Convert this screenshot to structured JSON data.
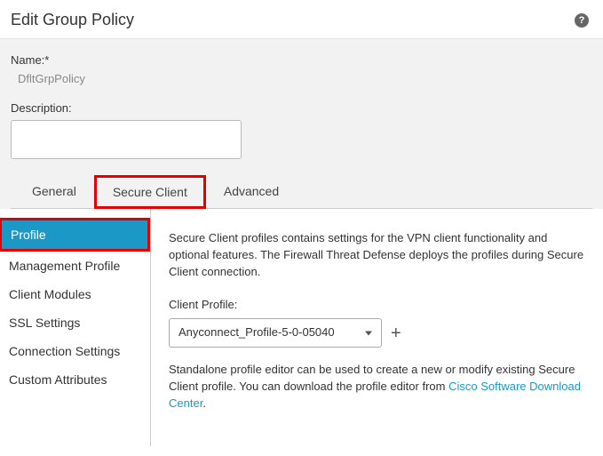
{
  "header": {
    "title": "Edit Group Policy",
    "help_glyph": "?"
  },
  "form": {
    "name_label": "Name:*",
    "name_value": "DfltGrpPolicy",
    "description_label": "Description:",
    "description_value": ""
  },
  "tabs": [
    {
      "label": "General"
    },
    {
      "label": "Secure Client",
      "highlighted": true
    },
    {
      "label": "Advanced"
    }
  ],
  "sidebar": [
    {
      "label": "Profile",
      "active": true
    },
    {
      "label": "Management Profile"
    },
    {
      "label": "Client Modules"
    },
    {
      "label": "SSL Settings"
    },
    {
      "label": "Connection Settings"
    },
    {
      "label": "Custom Attributes"
    }
  ],
  "content": {
    "intro_text": "Secure Client profiles contains settings for the VPN client functionality and optional features. The Firewall Threat Defense deploys the profiles during Secure Client connection.",
    "client_profile_label": "Client Profile:",
    "client_profile_value": "Anyconnect_Profile-5-0-05040",
    "plus_glyph": "+",
    "standalone_text_before": "Standalone profile editor can be used to create a new or modify existing Secure Client profile. You can download the profile editor from ",
    "download_link_text": "Cisco Software Download Center",
    "standalone_text_after": "."
  }
}
